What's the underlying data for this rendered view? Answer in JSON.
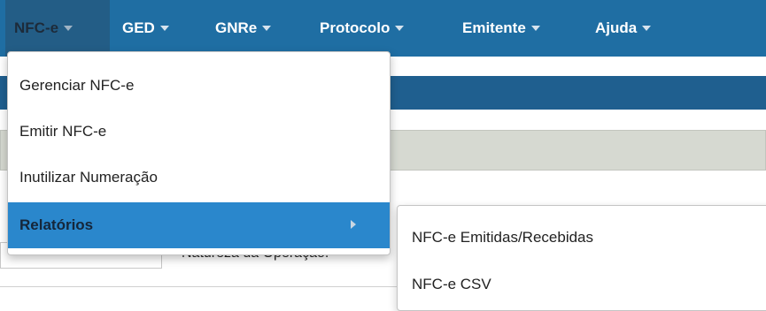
{
  "navbar": {
    "items": [
      {
        "label": "NFC-e"
      },
      {
        "label": "GED"
      },
      {
        "label": "GNRe"
      },
      {
        "label": "Protocolo"
      },
      {
        "label": "Emitente"
      },
      {
        "label": "Ajuda"
      }
    ]
  },
  "background": {
    "field_label": "Natureza da Operação:"
  },
  "dropdown": {
    "items": [
      {
        "label": "Gerenciar NFC-e"
      },
      {
        "label": "Emitir NFC-e"
      },
      {
        "label": "Inutilizar Numeração"
      },
      {
        "label": "Relatórios"
      }
    ]
  },
  "submenu": {
    "items": [
      {
        "label": "NFC-e Emitidas/Recebidas"
      },
      {
        "label": "NFC-e CSV"
      }
    ]
  },
  "colors": {
    "navbar": "#1f6ea3",
    "active_item": "#2a87cc"
  }
}
